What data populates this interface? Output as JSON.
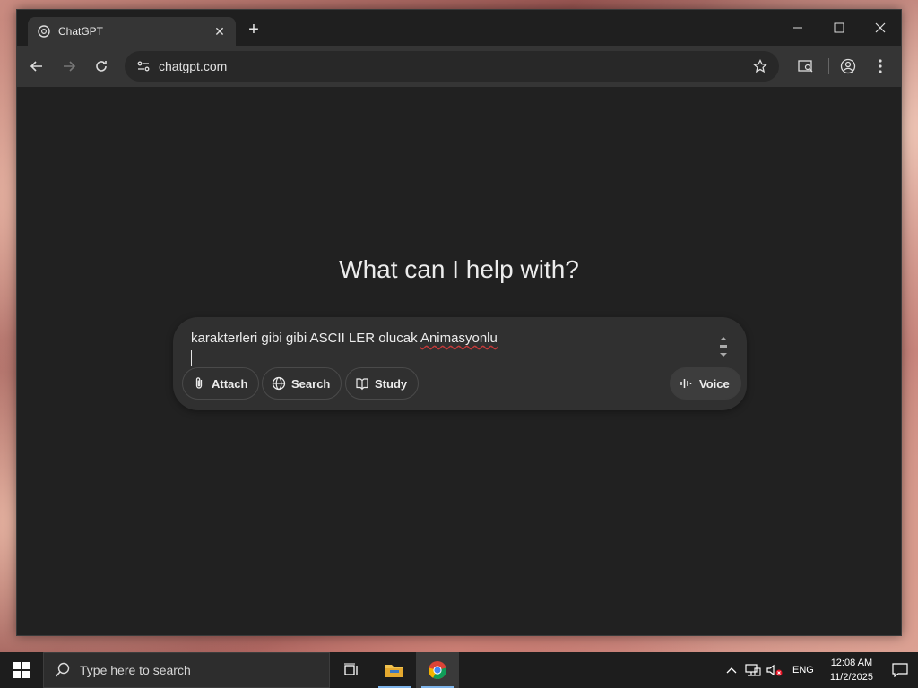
{
  "browser": {
    "tab_title": "ChatGPT",
    "url": "chatgpt.com"
  },
  "page": {
    "heading": "What can I help with?",
    "composer": {
      "text_plain": "karakterleri gibi gibi ASCII LER olucak ",
      "text_misspelled": "Animasyonlu",
      "buttons": {
        "attach": "Attach",
        "search": "Search",
        "study": "Study",
        "voice": "Voice"
      }
    }
  },
  "taskbar": {
    "search_placeholder": "Type here to search",
    "language": "ENG",
    "time": "12:08 AM",
    "date": "11/2/2025"
  },
  "colors": {
    "background": "#212121",
    "composer": "#303030",
    "text": "#ececec",
    "spellcheck": "#c43a3a"
  }
}
